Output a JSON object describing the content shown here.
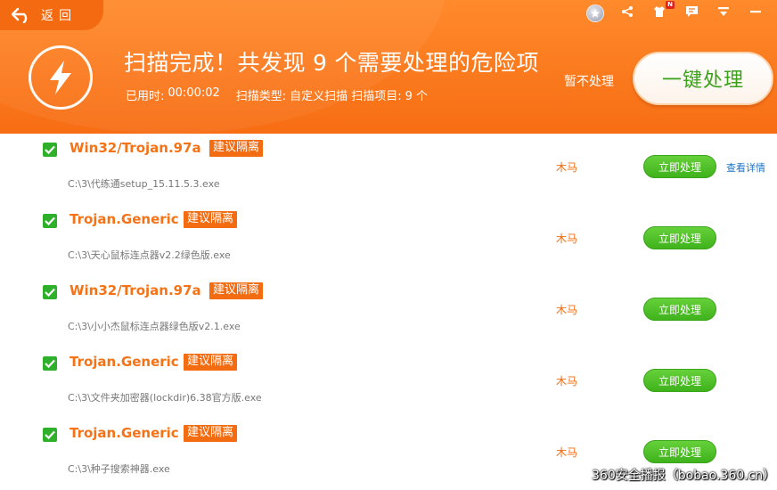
{
  "header": {
    "back_label": "返回",
    "title_prefix": "扫描完成！共发现",
    "title_count": "9",
    "title_suffix": "个需要处理的危险项",
    "meta": {
      "elapsed_label": "已用时:",
      "elapsed_value": "00:00:02",
      "scan_type_label": "扫描类型:",
      "scan_type_value": "自定义扫描",
      "scan_items_label": "扫描项目:",
      "scan_items_value": "9 个"
    },
    "skip_label": "暂不处理",
    "oneclick_label": "一键处理",
    "notification_badge": "N"
  },
  "threats": [
    {
      "name": "Win32/Trojan.97a",
      "tag": "建议隔离",
      "path": "C:\\3\\代练通setup_15.11.5.3.exe",
      "type": "木马",
      "action": "立即处理",
      "detail": "查看详情"
    },
    {
      "name": "Trojan.Generic",
      "tag": "建议隔离",
      "path": "C:\\3\\天心鼠标连点器v2.2绿色版.exe",
      "type": "木马",
      "action": "立即处理"
    },
    {
      "name": "Win32/Trojan.97a",
      "tag": "建议隔离",
      "path": "C:\\3\\小小杰鼠标连点器绿色版v2.1.exe",
      "type": "木马",
      "action": "立即处理"
    },
    {
      "name": "Trojan.Generic",
      "tag": "建议隔离",
      "path": "C:\\3\\文件夹加密器(lockdir)6.38官方版.exe",
      "type": "木马",
      "action": "立即处理"
    },
    {
      "name": "Trojan.Generic",
      "tag": "建议隔离",
      "path": "C:\\3\\种子搜索神器.exe",
      "type": "木马",
      "action": "立即处理"
    }
  ],
  "watermark": "360安全播报（bobao.360.cn）",
  "colors": {
    "header_orange": "#fb7a1e",
    "threat_orange": "#f57317",
    "action_green": "#3fb21c",
    "link_blue": "#1e73c4"
  }
}
